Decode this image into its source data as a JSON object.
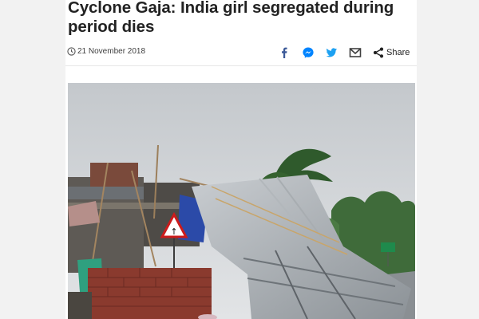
{
  "article": {
    "headline": "Cyclone Gaja: India girl segregated during period dies",
    "date": "21 November 2018"
  },
  "share": {
    "label": "Share",
    "icons": [
      "facebook-icon",
      "messenger-icon",
      "twitter-icon",
      "email-icon",
      "share-icon"
    ]
  },
  "photo": {
    "sign_glyph": "↑"
  },
  "colors": {
    "headline": "#222222",
    "facebook": "#3b5998",
    "messenger": "#0084ff",
    "twitter": "#1da1f2",
    "email": "#404040"
  }
}
